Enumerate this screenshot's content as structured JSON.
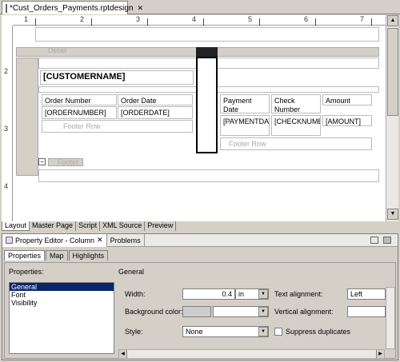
{
  "editor": {
    "tab_title": "*Cust_Orders_Payments.rptdesign",
    "close_glyph": "✕"
  },
  "ruler": {
    "h_labels": [
      "1",
      "2",
      "3",
      "4",
      "5",
      "6",
      "7"
    ],
    "v_labels": [
      "2",
      "3",
      "4"
    ]
  },
  "report": {
    "header_row_label": "Detail",
    "customer_name": "[CUSTOMERNAME]",
    "orders_table": {
      "headers": [
        "Order Number",
        "Order Date"
      ],
      "row": [
        "[ORDERNUMBER]",
        "[ORDERDATE]"
      ],
      "footer": "Footer Row"
    },
    "payments_table": {
      "headers": [
        "Payment Date",
        "Check Number",
        "Amount"
      ],
      "row": [
        "[PAYMENTDATE]",
        "[CHECKNUMBER]",
        "[AMOUNT]"
      ],
      "footer": "Footer Row"
    },
    "footer_label": "Footer"
  },
  "bottom_tabs": [
    "Layout",
    "Master Page",
    "Script",
    "XML Source",
    "Preview"
  ],
  "property_editor": {
    "title": "Property Editor - Column",
    "problems_tab": "Problems",
    "sub_tabs": [
      "Properties",
      "Map",
      "Highlights"
    ],
    "properties_label": "Properties:",
    "general_heading": "General",
    "categories": [
      "General",
      "Font",
      "Visibility"
    ],
    "width_label": "Width:",
    "width_value": "0.4",
    "width_unit": "in",
    "text_alignment_label": "Text alignment:",
    "text_alignment_value": "Left",
    "background_color_label": "Background color:",
    "vertical_alignment_label": "Vertical alignment:",
    "style_label": "Style:",
    "style_value": "None",
    "suppress_label": "Suppress duplicates"
  }
}
